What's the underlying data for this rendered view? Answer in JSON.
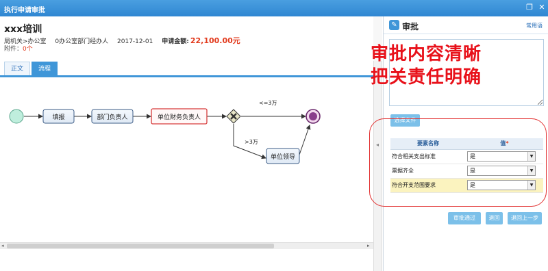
{
  "window": {
    "title": "执行申请审批",
    "restore_icon": "restore-icon",
    "close_icon": "close-icon"
  },
  "document": {
    "title": "xxx培训",
    "department": "局机关>办公室",
    "handler": "0办公室部门经办人",
    "date": "2017-12-01",
    "amount_label": "申请金额:",
    "amount": "22,100.00元",
    "attachment_label": "附件：",
    "attachment_count": "0个"
  },
  "tabs": [
    {
      "label": "正文",
      "active": false
    },
    {
      "label": "流程",
      "active": true
    }
  ],
  "flow": {
    "nodes": [
      {
        "id": "start",
        "type": "start",
        "label": ""
      },
      {
        "id": "fill",
        "type": "task",
        "label": "填报"
      },
      {
        "id": "dept",
        "type": "task",
        "label": "部门负责人"
      },
      {
        "id": "fin",
        "type": "task",
        "label": "单位财务负责人",
        "current": true
      },
      {
        "id": "gw",
        "type": "gateway",
        "label": ""
      },
      {
        "id": "lead",
        "type": "task",
        "label": "单位领导"
      },
      {
        "id": "end",
        "type": "end",
        "label": ""
      }
    ],
    "edge_labels": {
      "le": "<=3万",
      "gt": ">3万"
    }
  },
  "annotation": {
    "line1": "审批内容清晰",
    "line2": "把关责任明确"
  },
  "approval": {
    "title": "审批",
    "common_phrases": "常用语",
    "comment_value": "",
    "select_file_button": "选择文件",
    "table": {
      "header_name": "要素名称",
      "header_value": "值",
      "required_mark": "*",
      "rows": [
        {
          "name": "符合相关支出标准",
          "value": "是",
          "highlighted": false
        },
        {
          "name": "票据齐全",
          "value": "是",
          "highlighted": false
        },
        {
          "name": "符合开支范围要求",
          "value": "是",
          "highlighted": true
        }
      ]
    },
    "buttons": {
      "approve": "审批通过",
      "reject": "退回",
      "back_prev": "退回上一步"
    }
  },
  "colors": {
    "titlebar": "#3a8fd8",
    "accent": "#3f96d8",
    "button": "#7cc0e9",
    "annotation": "#e8111a",
    "amount": "#e23b1e",
    "start_node": "#bfeedd",
    "end_node": "#8a3d8c",
    "highlight_row": "#fbf3bf"
  }
}
